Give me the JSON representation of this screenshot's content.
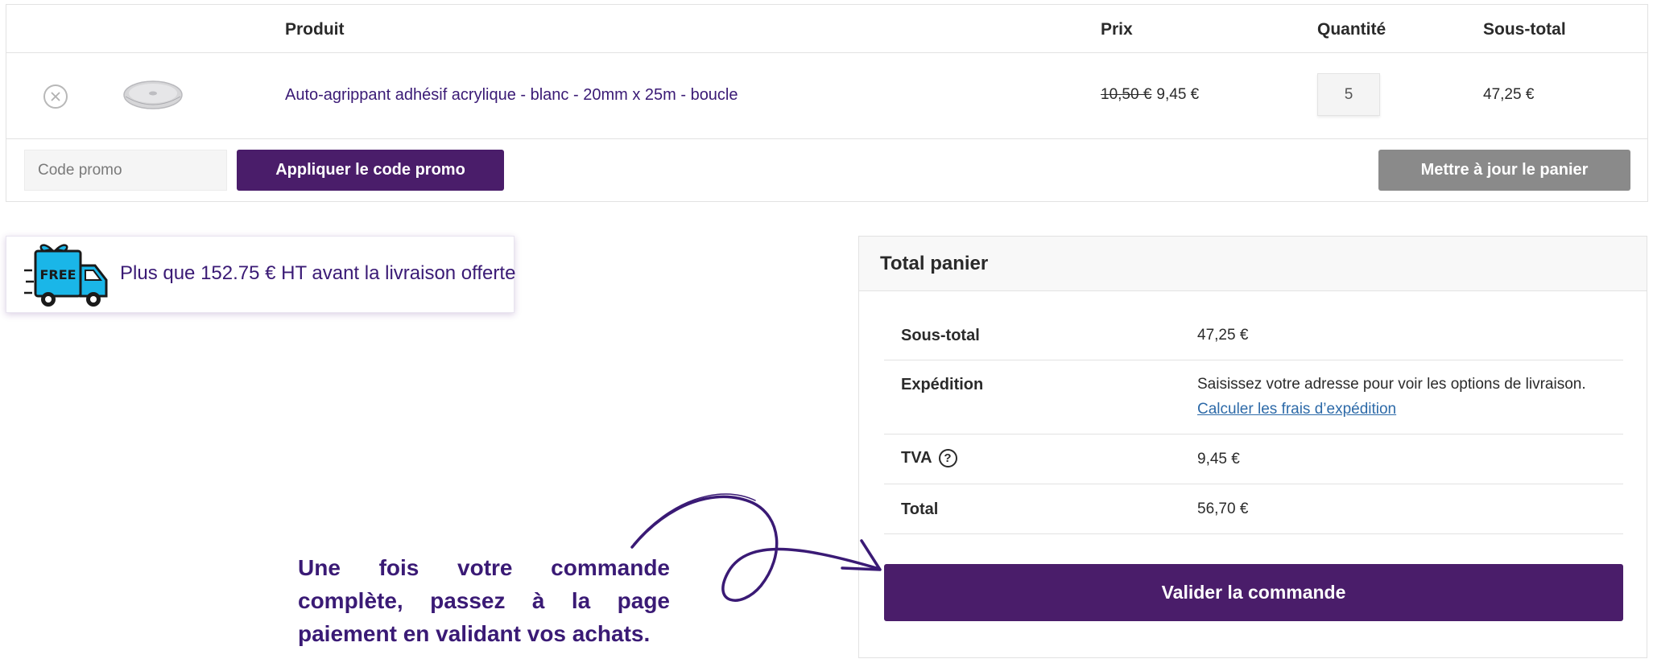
{
  "cart": {
    "headers": {
      "product": "Produit",
      "price": "Prix",
      "quantity": "Quantité",
      "subtotal": "Sous-total"
    },
    "item": {
      "name": "Auto-agrippant adhésif acrylique - blanc - 20mm x 25m - boucle",
      "old_price": "10,50 €",
      "price": "9,45 €",
      "quantity": "5",
      "subtotal": "47,25 €"
    },
    "coupon": {
      "placeholder": "Code promo",
      "apply_label": "Appliquer le code promo"
    },
    "update_label": "Mettre à jour le panier"
  },
  "shipping_banner": {
    "icon_text": "FREE",
    "text": "Plus que 152.75 € HT avant la livraison offerte"
  },
  "totals": {
    "title": "Total panier",
    "subtotal_label": "Sous-total",
    "subtotal_value": "47,25 €",
    "shipping_label": "Expédition",
    "shipping_text": "Saisissez votre adresse pour voir les options de livraison.",
    "shipping_link": "Calculer les frais d’expédition",
    "tax_label": "TVA",
    "tax_help": "?",
    "tax_value": "9,45 €",
    "total_label": "Total",
    "total_value": "56,70 €",
    "checkout_label": "Valider la commande"
  },
  "annotation": {
    "text": "Une fois votre commande complète, passez à la page paiement en validant vos achats."
  },
  "colors": {
    "brand": "#4a1d6a",
    "link": "#2d6aa8",
    "text_purple": "#3a1a75",
    "update_button": "#8a8a8a",
    "truck": "#1ab6e8"
  }
}
